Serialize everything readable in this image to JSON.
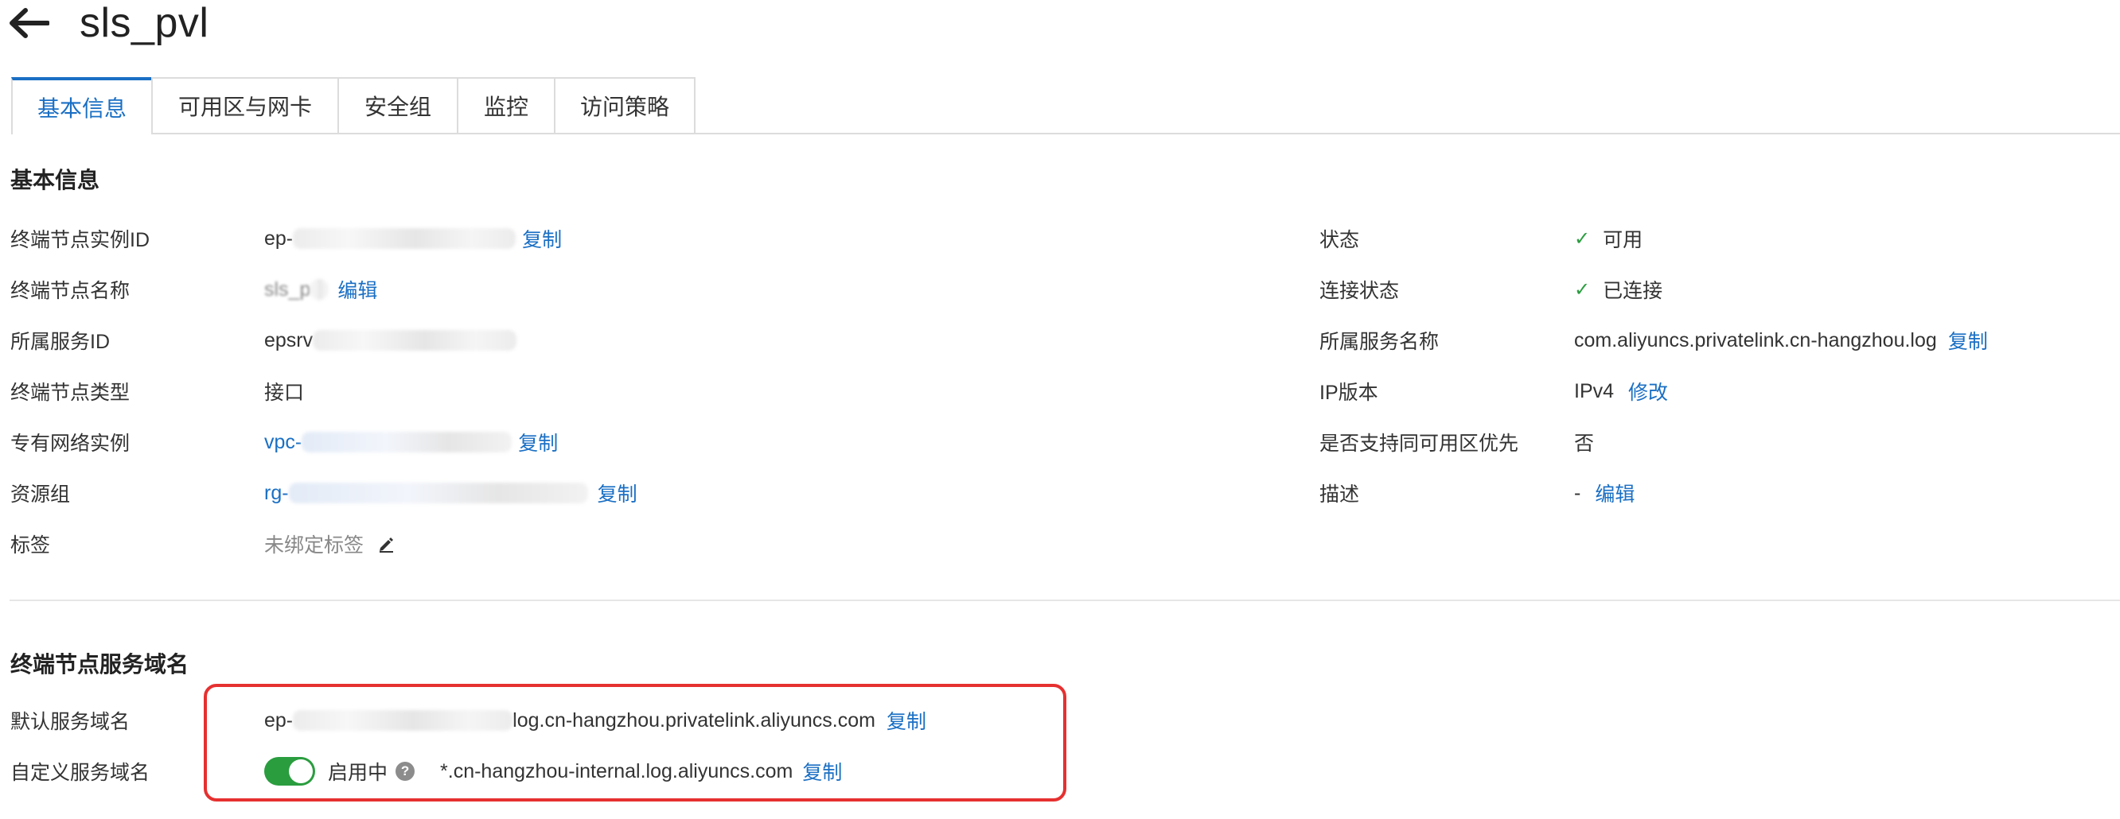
{
  "header": {
    "title": "sls_pvl"
  },
  "tabs": [
    {
      "label": "基本信息"
    },
    {
      "label": "可用区与网卡"
    },
    {
      "label": "安全组"
    },
    {
      "label": "监控"
    },
    {
      "label": "访问策略"
    }
  ],
  "basic_info": {
    "title": "基本信息",
    "left": {
      "endpoint_id": {
        "label": "终端节点实例ID",
        "value_prefix": "ep-",
        "action": "复制"
      },
      "endpoint_name": {
        "label": "终端节点名称",
        "value_prefix": "sls_p",
        "action": "编辑"
      },
      "service_id": {
        "label": "所属服务ID",
        "value_prefix": "epsrv"
      },
      "endpoint_type": {
        "label": "终端节点类型",
        "value": "接口"
      },
      "vpc": {
        "label": "专有网络实例",
        "value_prefix": "vpc-",
        "action": "复制"
      },
      "resource_group": {
        "label": "资源组",
        "value_prefix": "rg-",
        "action": "复制"
      },
      "tags": {
        "label": "标签",
        "value": "未绑定标签"
      }
    },
    "right": {
      "status": {
        "label": "状态",
        "value": "可用"
      },
      "connection_status": {
        "label": "连接状态",
        "value": "已连接"
      },
      "service_name": {
        "label": "所属服务名称",
        "value": "com.aliyuncs.privatelink.cn-hangzhou.log",
        "action": "复制"
      },
      "ip_version": {
        "label": "IP版本",
        "value": "IPv4",
        "action": "修改"
      },
      "same_zone": {
        "label": "是否支持同可用区优先",
        "value": "否"
      },
      "description": {
        "label": "描述",
        "value": "-",
        "action": "编辑"
      }
    }
  },
  "domain_section": {
    "title": "终端节点服务域名",
    "default_domain": {
      "label": "默认服务域名",
      "value_prefix": "ep-",
      "value_suffix": "log.cn-hangzhou.privatelink.aliyuncs.com",
      "action": "复制"
    },
    "custom_domain": {
      "label": "自定义服务域名",
      "toggle_on": true,
      "status": "启用中",
      "value": "*.cn-hangzhou-internal.log.aliyuncs.com",
      "action": "复制"
    }
  },
  "colors": {
    "accent": "#1a6fc4",
    "success": "#2a9d3f",
    "highlight": "#e63030"
  }
}
